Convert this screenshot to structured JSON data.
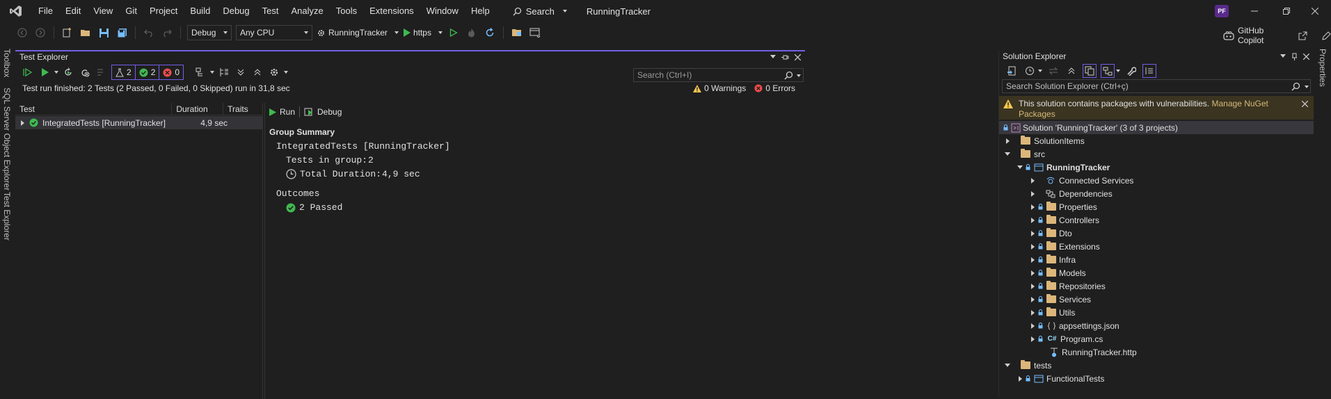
{
  "menu": {
    "items": [
      "File",
      "Edit",
      "View",
      "Git",
      "Project",
      "Build",
      "Debug",
      "Test",
      "Analyze",
      "Tools",
      "Extensions",
      "Window",
      "Help"
    ],
    "search_label": "Search",
    "app_title": "RunningTracker",
    "avatar_initials": "PF"
  },
  "toolbar": {
    "config": "Debug",
    "platform": "Any CPU",
    "startup_project": "RunningTracker",
    "launch_profile": "https",
    "copilot_label": "GitHub Copilot"
  },
  "left_tabs": [
    "Toolbox",
    "SQL Server Object Explorer",
    "Test Explorer"
  ],
  "right_tabs": [
    "Properties"
  ],
  "test_explorer": {
    "title": "Test Explorer",
    "badges": {
      "total": "2",
      "passed": "2",
      "failed": "0"
    },
    "search_placeholder": "Search (Ctrl+I)",
    "status": "Test run finished: 2 Tests (2 Passed, 0 Failed, 0 Skipped) run in 31,8 sec",
    "warnings": "0 Warnings",
    "errors": "0 Errors",
    "columns": {
      "test": "Test",
      "duration": "Duration",
      "traits": "Traits"
    },
    "rows": [
      {
        "name": "IntegratedTests [RunningTracker]",
        "duration": "4,9 sec"
      }
    ],
    "detail": {
      "run_label": "Run",
      "debug_label": "Debug",
      "group_summary": "Group Summary",
      "group_name": "IntegratedTests [RunningTracker]",
      "tests_in_group_label": "Tests in group:",
      "tests_in_group_value": "2",
      "total_duration_label": "Total Duration:",
      "total_duration_value": "4,9 sec",
      "outcomes_label": "Outcomes",
      "passed_text": "2 Passed"
    }
  },
  "solution_explorer": {
    "title": "Solution Explorer",
    "search_placeholder": "Search Solution Explorer (Ctrl+ç)",
    "warning_text": "This solution contains packages with vulnerabilities.",
    "warning_link": "Manage NuGet Packages",
    "tree": [
      {
        "label": "Solution 'RunningTracker' (3 of 3 projects)",
        "icon": "solution-icon"
      },
      {
        "label": "SolutionItems",
        "icon": "folder-icon"
      },
      {
        "label": "src",
        "icon": "folder-icon"
      },
      {
        "label": "RunningTracker",
        "icon": "project-icon"
      },
      {
        "label": "Connected Services",
        "icon": "connected-services-icon"
      },
      {
        "label": "Dependencies",
        "icon": "dependencies-icon"
      },
      {
        "label": "Properties",
        "icon": "properties-icon"
      },
      {
        "label": "Controllers",
        "icon": "folder-icon"
      },
      {
        "label": "Dto",
        "icon": "folder-icon"
      },
      {
        "label": "Extensions",
        "icon": "folder-icon"
      },
      {
        "label": "Infra",
        "icon": "folder-icon"
      },
      {
        "label": "Models",
        "icon": "folder-icon"
      },
      {
        "label": "Repositories",
        "icon": "folder-icon"
      },
      {
        "label": "Services",
        "icon": "folder-icon"
      },
      {
        "label": "Utils",
        "icon": "folder-icon"
      },
      {
        "label": "appsettings.json",
        "icon": "json-file-icon"
      },
      {
        "label": "Program.cs",
        "icon": "csharp-file-icon"
      },
      {
        "label": "RunningTracker.http",
        "icon": "http-file-icon"
      },
      {
        "label": "tests",
        "icon": "folder-icon"
      },
      {
        "label": "FunctionalTests",
        "icon": "project-icon"
      }
    ]
  },
  "colors": {
    "accent": "#7160e8",
    "pass": "#3fb950",
    "fail": "#f14c4c",
    "warning": "#f9c74f",
    "folder": "#dcb67a"
  }
}
